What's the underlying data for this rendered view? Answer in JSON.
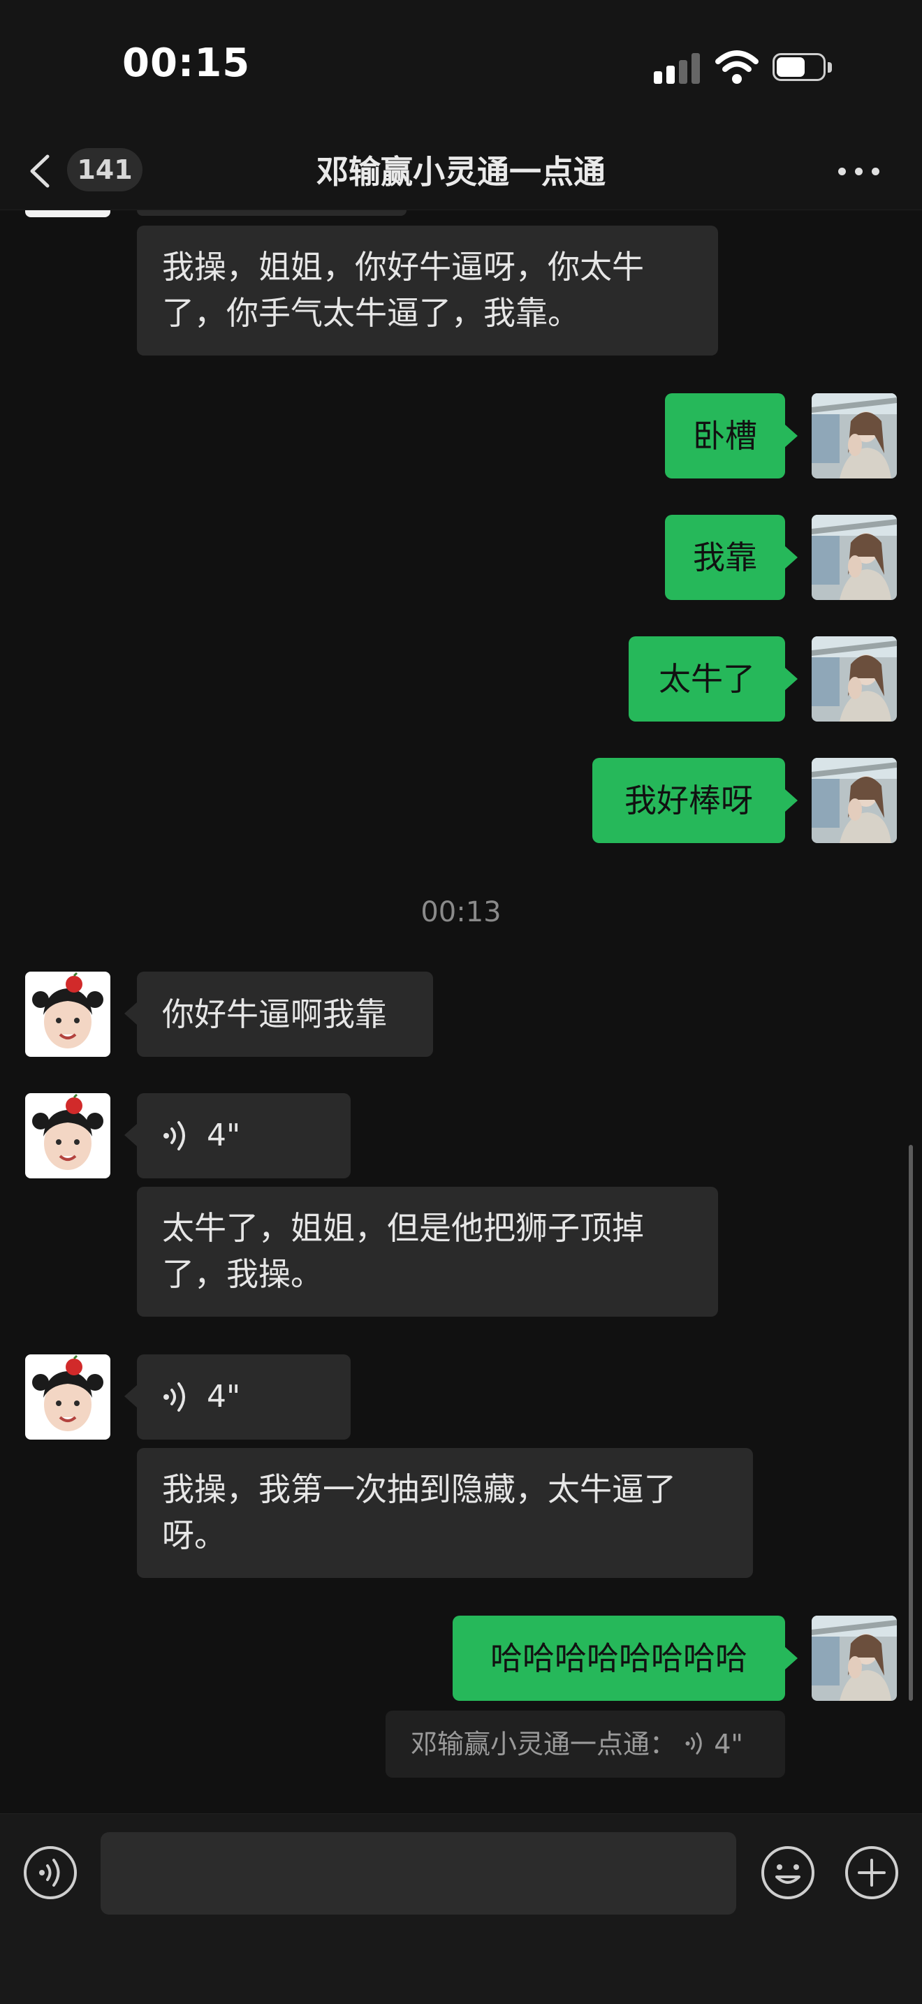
{
  "status_bar": {
    "time": "00:15"
  },
  "nav": {
    "unread_count": "141",
    "title": "邓输赢小灵通一点通"
  },
  "messages": {
    "top_incoming": "我操，姐姐，你好牛逼呀，你太牛了，你手气太牛逼了，我靠。",
    "out_1": "卧槽",
    "out_2": "我靠",
    "out_3": "太牛了",
    "out_4": "我好棒呀",
    "divider_time": "00:13",
    "in_1": "你好牛逼啊我靠",
    "voice_1_duration": "4\"",
    "voice_1_transcript": "太牛了，姐姐，但是他把狮子顶掉了，我操。",
    "voice_2_duration": "4\"",
    "voice_2_transcript": "我操，我第一次抽到隐藏，太牛逼了呀。",
    "out_5": "哈哈哈哈哈哈哈哈",
    "quote_sender": "邓输赢小灵通一点通：",
    "quote_duration": "4\""
  },
  "input": {
    "placeholder": ""
  },
  "colors": {
    "background": "#111111",
    "outgoing_bubble": "#26b85a",
    "incoming_bubble": "#2a2a2a"
  },
  "icons": {
    "back": "chevron-left-icon",
    "more": "ellipsis-icon",
    "voice": "voice-wave-icon",
    "emoji": "smiley-icon",
    "plus": "plus-circle-icon"
  }
}
